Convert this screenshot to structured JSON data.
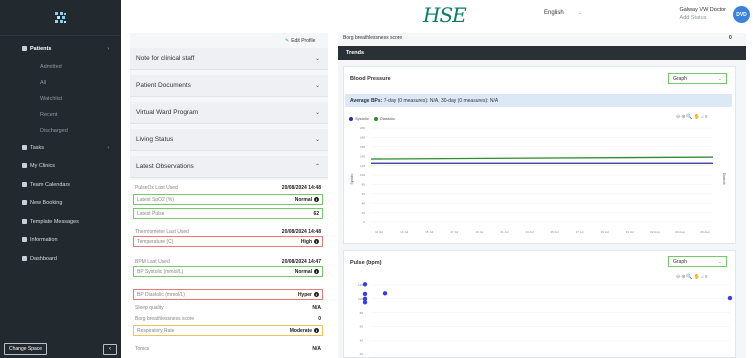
{
  "sidebar": {
    "items": [
      {
        "label": "Patients",
        "active": true,
        "chevron": "›"
      },
      {
        "label": "Admitted",
        "sub": true
      },
      {
        "label": "All",
        "sub": true
      },
      {
        "label": "Watchlist",
        "sub": true
      },
      {
        "label": "Recent",
        "sub": true
      },
      {
        "label": "Discharged",
        "sub": true
      },
      {
        "label": "Tasks",
        "chevron": "›"
      },
      {
        "label": "My Clinics"
      },
      {
        "label": "Team Calendars"
      },
      {
        "label": "New Booking"
      },
      {
        "label": "Template Messages"
      },
      {
        "label": "Information"
      },
      {
        "label": "Dashboard"
      }
    ],
    "change_space": "Change Space",
    "collapse": "‹"
  },
  "header": {
    "logo": "HSE",
    "language": "English",
    "user_name": "Galway VW Doctor",
    "user_status": "Add Status",
    "avatar": "DVD"
  },
  "left": {
    "edit_profile": "Edit Profile",
    "sections": [
      "Note for clinical staff",
      "Patient Documents",
      "Virtual Ward Program",
      "Living Status",
      "Latest Observations"
    ],
    "observations": [
      {
        "label": "PulseOx Last Used",
        "value": "20/08/2024 14:48",
        "style": "plain"
      },
      {
        "label": "Latest SpO2 (%)",
        "value": "Normal",
        "style": "green",
        "info": true
      },
      {
        "label": "Latest Pulse",
        "value": "62",
        "style": "green"
      },
      {
        "label": "Thermometer Last Used",
        "value": "20/08/2024 14:48",
        "style": "plain"
      },
      {
        "label": "Temperature (C)",
        "value": "High",
        "style": "red",
        "info": true
      },
      {
        "label": "BPM Last Used",
        "value": "20/08/2024 14:47",
        "style": "plain"
      },
      {
        "label": "BP Systolic (mmol/L)",
        "value": "Normal",
        "style": "green",
        "info": true
      },
      {
        "label": "BP Diastolic (mmol/L)",
        "value": "Hyper",
        "style": "red",
        "info": true
      },
      {
        "label": "Sleep quality",
        "value": "N/A",
        "style": "plain"
      },
      {
        "label": "Borg breathlessness score",
        "value": "0",
        "style": "plain"
      },
      {
        "label": "Respiratory Rate",
        "value": "Moderate",
        "style": "yellow",
        "info": true
      },
      {
        "label": "Tonics",
        "value": "N/A",
        "style": "plain"
      }
    ]
  },
  "right": {
    "borg_label": "Borg breathlessness score",
    "borg_value": "0",
    "trends": "Trends",
    "bp": {
      "title": "Blood Pressure",
      "view": "Graph",
      "avg_label": "Average BPs:",
      "avg_text": "7-day (0 measures): N/A, 30-day (0 measures): N/A",
      "legend": [
        "Systolic",
        "Diastolic"
      ],
      "y_ticks": [
        "200",
        "180",
        "160",
        "140",
        "120",
        "100",
        "80",
        "60",
        "40",
        "20",
        "0"
      ],
      "x_ticks": [
        "11 Jul",
        "13 Jul",
        "15 Jul",
        "17 Jul",
        "19 Jul",
        "21 Jul",
        "23 Jul",
        "25 Jul",
        "27 Jul",
        "29 Jul",
        "31 Jul",
        "02 Aug",
        "04 Aug",
        "06 Aug"
      ],
      "y_label_left": "Systolic",
      "y_label_right": "Diastolic"
    },
    "pulse": {
      "title": "Pulse (bpm)",
      "view": "Graph",
      "y_ticks": [
        "120",
        "100",
        "80",
        "60",
        "40",
        "20"
      ]
    }
  },
  "colors": {
    "systolic": "#2a2f9e",
    "diastolic": "#2e8b2e",
    "pulse": "#3a3de0",
    "accent_green": "#76c96b",
    "sidebar_bg": "#22292f"
  },
  "chart_data": [
    {
      "type": "line",
      "title": "Blood Pressure",
      "series": [
        {
          "name": "Systolic",
          "values": [
            125,
            125
          ]
        },
        {
          "name": "Diastolic",
          "values": [
            134,
            138
          ]
        }
      ],
      "ylim": [
        0,
        200
      ]
    },
    {
      "type": "scatter",
      "title": "Pulse (bpm)",
      "points": [
        [
          0,
          121
        ],
        [
          0,
          107
        ],
        [
          0,
          100
        ],
        [
          0,
          95
        ],
        [
          1,
          108
        ],
        [
          2,
          101
        ]
      ],
      "ylim": [
        20,
        120
      ]
    }
  ]
}
